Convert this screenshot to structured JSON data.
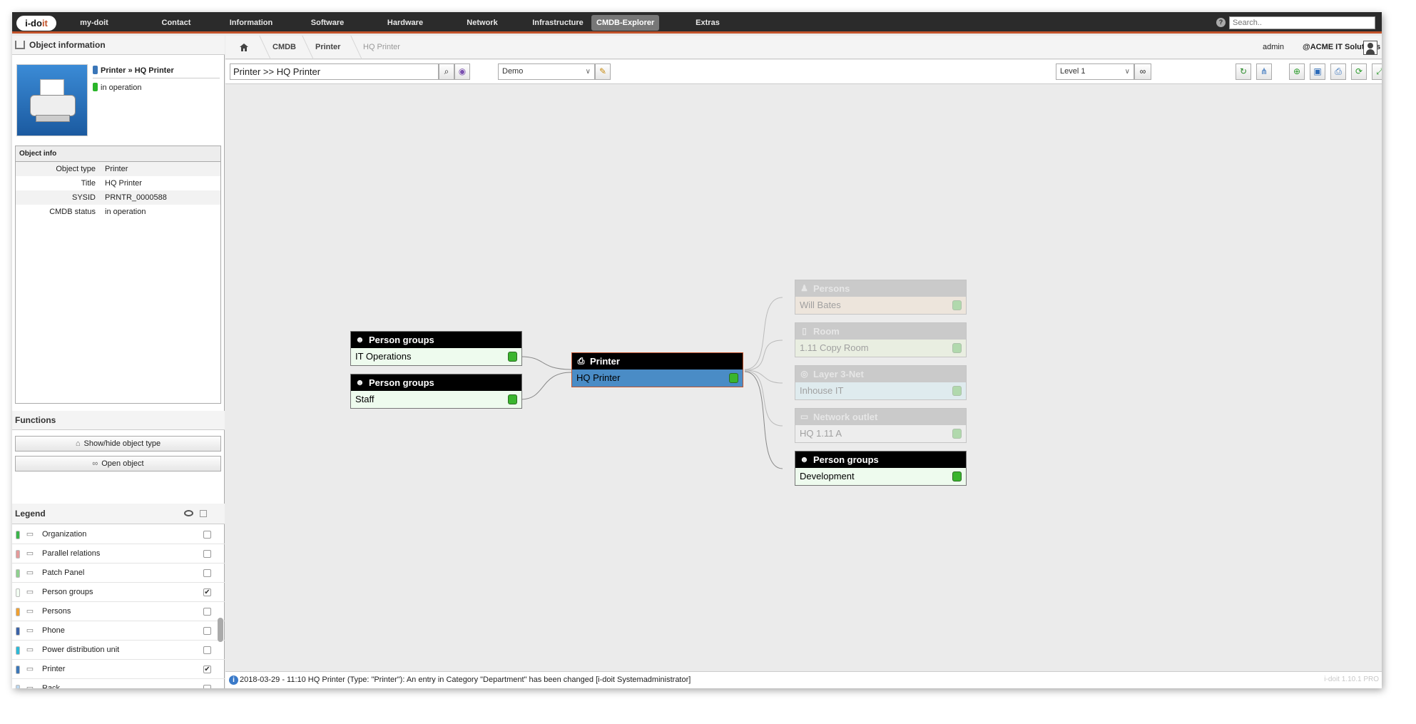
{
  "nav": {
    "logo_pre": "i-do",
    "logo_post": "it",
    "items": [
      "my-doit",
      "Contact",
      "Information",
      "Software",
      "Hardware",
      "Network",
      "Infrastructure",
      "CMDB-Explorer",
      "Extras"
    ],
    "active": "CMDB-Explorer",
    "help": "?",
    "search_placeholder": "Search.."
  },
  "object_information": {
    "heading": "Object information",
    "object_type_label": "Printer",
    "object_title_label": "HQ Printer",
    "separator": "»",
    "status": "in operation",
    "type_color": "#3a76b8",
    "status_color": "#2ab52a",
    "info_heading": "Object info",
    "rows": [
      {
        "key": "Object type",
        "value": "Printer"
      },
      {
        "key": "Title",
        "value": "HQ Printer"
      },
      {
        "key": "SYSID",
        "value": "PRNTR_0000588"
      },
      {
        "key": "CMDB status",
        "value": "in operation"
      }
    ]
  },
  "functions": {
    "heading": "Functions",
    "buttons": [
      "Show/hide object type",
      "Open object"
    ]
  },
  "legend": {
    "heading": "Legend",
    "items": [
      {
        "label": "Organization",
        "color": "#3bb54a",
        "icon": "organization-icon",
        "checked": false
      },
      {
        "label": "Parallel relations",
        "color": "#e49a9a",
        "icon": "document-icon",
        "checked": false
      },
      {
        "label": "Patch Panel",
        "color": "#8fd18f",
        "icon": "patch-panel-icon",
        "checked": false
      },
      {
        "label": "Person groups",
        "color": "#f2fff2",
        "icon": "person-groups-icon",
        "checked": true
      },
      {
        "label": "Persons",
        "color": "#f0a030",
        "icon": "person-icon",
        "checked": false
      },
      {
        "label": "Phone",
        "color": "#3a62a8",
        "icon": "phone-icon",
        "checked": false
      },
      {
        "label": "Power distribution unit",
        "color": "#2bbad8",
        "icon": "pdu-icon",
        "checked": false
      },
      {
        "label": "Printer",
        "color": "#3a76b8",
        "icon": "printer-icon",
        "checked": true
      },
      {
        "label": "Rack",
        "color": "#bcd7ef",
        "icon": "rack-icon",
        "checked": false
      }
    ],
    "check_mark": "✔"
  },
  "breadcrumb": {
    "items": [
      "CMDB",
      "Printer",
      "HQ Printer"
    ],
    "user": "admin",
    "tenant_prefix": "@",
    "tenant": "ACME IT Solutions"
  },
  "toolbar": {
    "path": "Printer >> HQ Printer",
    "profile_select": "Demo",
    "level_select": "Level 1"
  },
  "graph": {
    "center": {
      "type": "Printer",
      "name": "HQ Printer"
    },
    "left": [
      {
        "type": "Person groups",
        "name": "IT Operations"
      },
      {
        "type": "Person groups",
        "name": "Staff"
      }
    ],
    "right": [
      {
        "type": "Persons",
        "name": "Will Bates",
        "faded": true,
        "bg": "#f3d9bf"
      },
      {
        "type": "Room",
        "name": "1.11 Copy Room",
        "faded": true,
        "bg": "#e7f5cf"
      },
      {
        "type": "Layer 3-Net",
        "name": "Inhouse IT",
        "faded": true,
        "bg": "#c9ecf5"
      },
      {
        "type": "Network outlet",
        "name": "HQ 1.11 A",
        "faded": true,
        "bg": "#f2f2f2"
      },
      {
        "type": "Person groups",
        "name": "Development",
        "faded": false,
        "bg": "#eefbee"
      }
    ]
  },
  "statusbar": {
    "message": "2018-03-29 - 11:10 HQ Printer (Type: \"Printer\"): An entry in Category \"Department\" has been changed [i-doit Systemadministrator]",
    "version": "i-doit 1.10.1 PRO"
  }
}
